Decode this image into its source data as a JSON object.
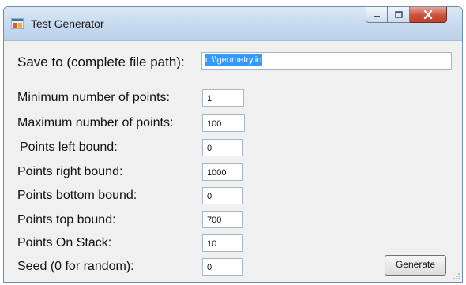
{
  "window": {
    "title": "Test Generator",
    "accent": "#c4d8ee",
    "close_color": "#c9503a"
  },
  "form": {
    "save_label": "Save to (complete file path):",
    "save_value": "c:\\\\geometry.in",
    "fields": [
      {
        "label": "Minimum number of points:",
        "value": "1"
      },
      {
        "label": "Maximum number of points:",
        "value": "100"
      },
      {
        "label": "Points left bound:",
        "value": "0"
      },
      {
        "label": "Points right bound:",
        "value": "1000"
      },
      {
        "label": "Points bottom bound:",
        "value": "0"
      },
      {
        "label": "Points top bound:",
        "value": "700"
      },
      {
        "label": "Points On Stack:",
        "value": "10"
      },
      {
        "label": "Seed (0 for random):",
        "value": "0"
      }
    ],
    "generate_label": "Generate"
  }
}
